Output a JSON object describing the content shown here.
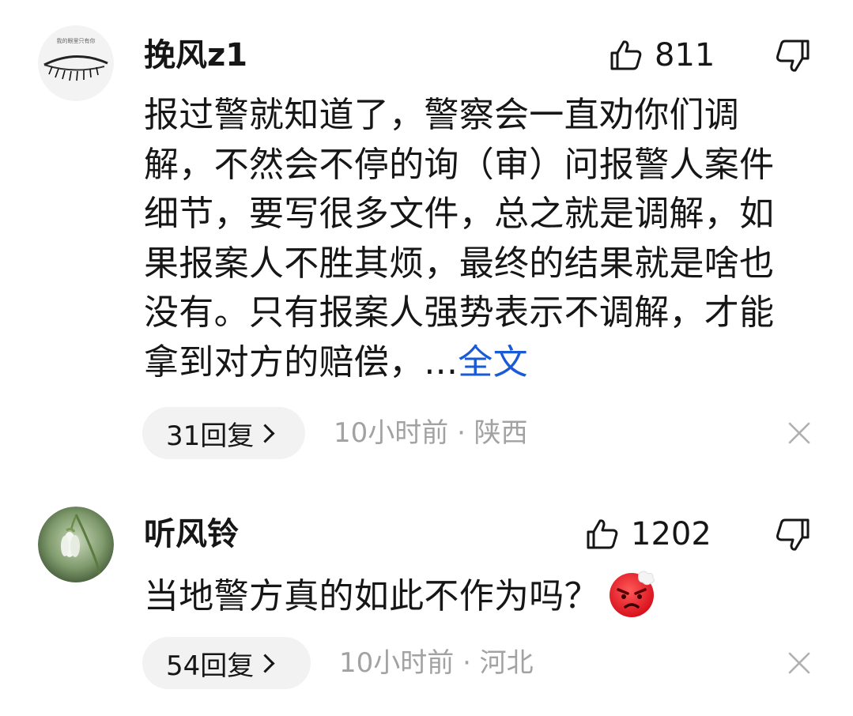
{
  "comments": [
    {
      "username": "挽风z1",
      "avatar_icon": "eye-lash-avatar",
      "avatar_caption": "我的眼里只有你",
      "likes": "811",
      "text": "报过警就知道了，警察会一直劝你们调解，不然会不停的询（审）问报警人案件细节，要写很多文件，总之就是调解，如果报案人不胜其烦，最终的结果就是啥也没有。只有报案人强势表示不调解，才能拿到对方的赔偿，...",
      "more_label": "全文",
      "reply_label": "31回复",
      "meta": "10小时前 · 陕西"
    },
    {
      "username": "听风铃",
      "avatar_icon": "snowdrop-flower-avatar",
      "likes": "1202",
      "text": "当地警方真的如此不作为吗？",
      "emoji_icon": "angry-face-emoji",
      "reply_label": "54回复",
      "meta": "10小时前 · 河北"
    }
  ],
  "colors": {
    "text": "#161616",
    "meta": "#a2a2a2",
    "link": "#1a5ad6",
    "pill_bg": "#f2f2f2"
  }
}
